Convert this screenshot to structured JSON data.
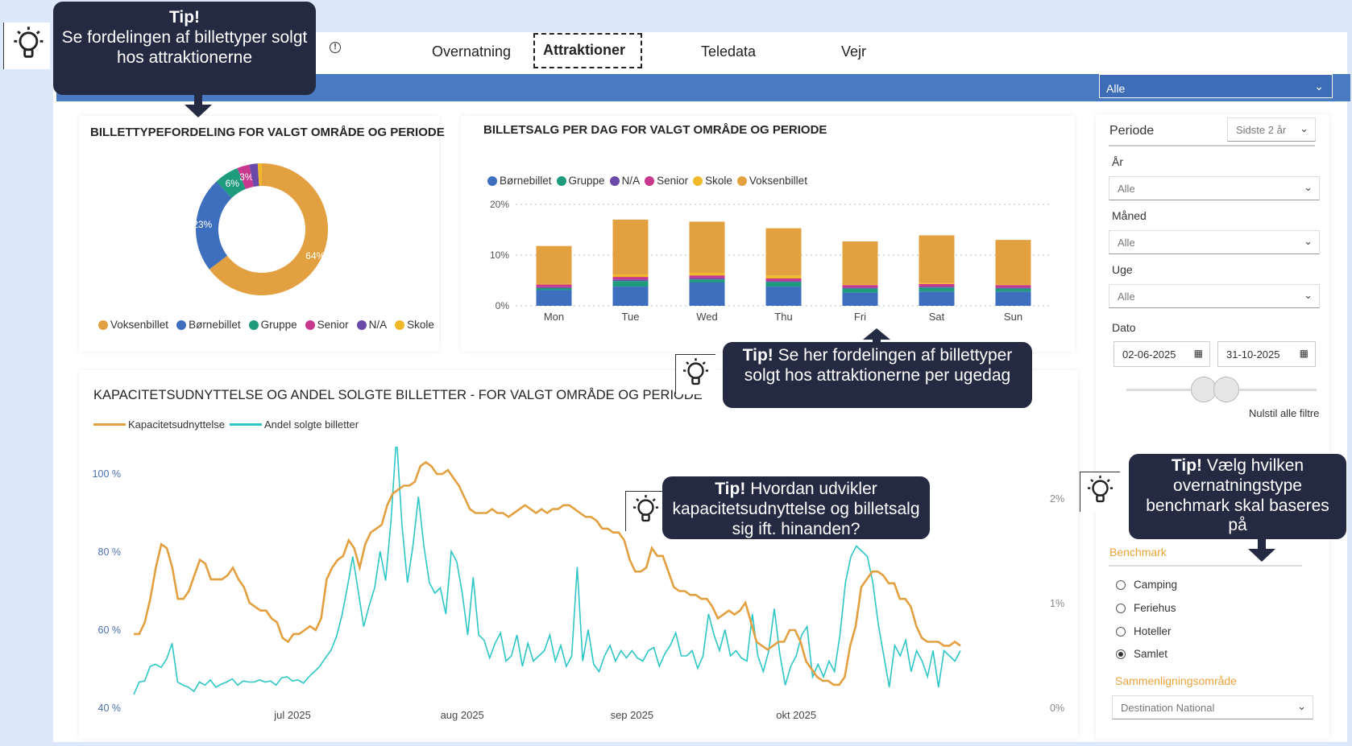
{
  "nav": {
    "tabs": [
      {
        "label": "Overnatning"
      },
      {
        "label": "Attraktioner"
      },
      {
        "label": "Teledata"
      },
      {
        "label": "Vejr"
      }
    ],
    "active_tab": "Attraktioner"
  },
  "top_filter": {
    "value": "Alle"
  },
  "donut": {
    "title": "BILLETTYPEFORDELING FOR VALGT OMRÅDE OG PERIODE",
    "legend": [
      "Voksenbillet",
      "Børnebillet",
      "Gruppe",
      "Senior",
      "N/A",
      "Skole"
    ]
  },
  "weekday": {
    "title": "BILLETSALG PER DAG FOR VALGT OMRÅDE OG PERIODE",
    "legend": [
      "Børnebillet",
      "Gruppe",
      "N/A",
      "Senior",
      "Skole",
      "Voksenbillet"
    ]
  },
  "line": {
    "title": "KAPACITETSUDNYTTELSE OG ANDEL SOLGTE BILLETTER - FOR VALGT OMRÅDE OG PERIODE",
    "legend": [
      "Kapacitetsudnyttelse",
      "Andel solgte billetter"
    ]
  },
  "colors": {
    "voksen": "#e3a040",
    "born": "#3e6fbf",
    "gruppe": "#1e9b7d",
    "senior": "#c9388f",
    "na": "#6b49a8",
    "skole": "#f0b92a",
    "kapacitet": "#e3a040",
    "andel": "#2ec6c6",
    "tip_bg": "#252a43",
    "band": "#4a7bc2"
  },
  "chart_data": [
    {
      "type": "pie",
      "title": "BILLETTYPEFORDELING FOR VALGT OMRÅDE OG PERIODE",
      "categories": [
        "Voksenbillet",
        "Børnebillet",
        "Gruppe",
        "Senior",
        "N/A",
        "Skole"
      ],
      "values": [
        64,
        23,
        6,
        3,
        2,
        1
      ],
      "labels": [
        "64%",
        "23%",
        "6%",
        "3%"
      ],
      "donut": true
    },
    {
      "type": "bar",
      "stacked": true,
      "title": "BILLETSALG PER DAG FOR VALGT OMRÅDE OG PERIODE",
      "categories": [
        "Mon",
        "Tue",
        "Wed",
        "Thu",
        "Fri",
        "Sat",
        "Sun"
      ],
      "series": [
        {
          "name": "Børnebillet",
          "values": [
            3.1,
            3.8,
            4.6,
            3.8,
            2.6,
            2.8,
            2.8
          ]
        },
        {
          "name": "Gruppe",
          "values": [
            0.4,
            1.1,
            0.6,
            0.9,
            0.8,
            0.8,
            0.6
          ]
        },
        {
          "name": "N/A",
          "values": [
            0.2,
            0.3,
            0.3,
            0.2,
            0.2,
            0.2,
            0.2
          ]
        },
        {
          "name": "Senior",
          "values": [
            0.5,
            0.5,
            0.5,
            0.5,
            0.5,
            0.5,
            0.5
          ]
        },
        {
          "name": "Skole",
          "values": [
            0.1,
            0.5,
            0.5,
            0.6,
            0.1,
            0.2,
            0.1
          ]
        },
        {
          "name": "Voksenbillet",
          "values": [
            7.5,
            10.8,
            10.1,
            9.3,
            8.5,
            9.4,
            8.8
          ]
        }
      ],
      "ylim": [
        0,
        20
      ],
      "yticks": [
        "0%",
        "10%",
        "20%"
      ]
    },
    {
      "type": "line",
      "title": "KAPACITETSUDNYTTELSE OG ANDEL SOLGTE BILLETTER - FOR VALGT OMRÅDE OG PERIODE",
      "x_range": [
        "2025-06-02",
        "2025-10-31"
      ],
      "xticks": [
        "jul 2025",
        "aug 2025",
        "sep 2025",
        "okt 2025"
      ],
      "y_left_ticks": [
        "40 %",
        "60 %",
        "80 %",
        "100 %"
      ],
      "y_right_ticks": [
        "0%",
        "1%",
        "2%"
      ],
      "y_left_lim": [
        40,
        107
      ],
      "y_right_lim": [
        0,
        2.5
      ],
      "series": [
        {
          "name": "Kapacitetsudnyttelse",
          "axis": "left",
          "values": [
            59,
            59,
            62,
            68,
            76,
            82,
            81,
            76,
            68,
            68,
            70,
            74,
            78,
            77,
            73,
            73,
            73,
            74,
            76,
            73,
            71,
            67,
            66,
            65,
            65,
            63,
            62,
            58,
            57,
            59,
            59,
            60,
            61,
            60,
            63,
            73,
            76,
            78,
            79,
            83,
            81,
            76,
            82,
            85,
            86,
            87,
            92,
            95,
            96,
            97,
            97,
            98,
            102,
            103,
            102,
            100,
            100,
            101,
            99,
            97,
            94,
            91,
            90,
            90,
            90,
            91,
            90,
            90,
            89,
            90,
            91,
            92,
            91,
            90,
            91,
            90,
            91,
            91,
            92,
            92,
            91,
            90,
            89,
            89,
            88,
            86,
            86,
            85,
            85,
            83,
            78,
            75,
            75,
            76,
            81,
            79,
            79,
            75,
            71,
            70,
            70,
            69,
            69,
            68,
            68,
            66,
            63,
            64,
            65,
            64,
            65,
            67,
            62,
            57,
            56,
            55,
            56,
            57,
            57,
            60,
            60,
            57,
            52,
            50,
            48,
            47,
            47,
            46,
            46,
            48,
            56,
            61,
            71,
            73,
            75,
            75,
            74,
            72,
            72,
            68,
            68,
            66,
            61,
            58,
            57,
            57,
            57,
            56,
            56,
            57,
            56
          ]
        },
        {
          "name": "Andel solgte billetter",
          "axis": "right",
          "values": [
            0.13,
            0.25,
            0.26,
            0.4,
            0.42,
            0.39,
            0.47,
            0.62,
            0.25,
            0.22,
            0.2,
            0.16,
            0.25,
            0.22,
            0.27,
            0.2,
            0.23,
            0.25,
            0.28,
            0.22,
            0.26,
            0.25,
            0.25,
            0.27,
            0.25,
            0.26,
            0.22,
            0.29,
            0.3,
            0.26,
            0.27,
            0.24,
            0.3,
            0.35,
            0.4,
            0.48,
            0.55,
            0.68,
            0.88,
            1.15,
            1.45,
            1.12,
            0.78,
            0.98,
            1.15,
            1.5,
            1.22,
            1.8,
            2.6,
            1.75,
            1.2,
            1.55,
            2.02,
            1.55,
            1.2,
            1.1,
            1.15,
            0.9,
            1.5,
            1.4,
            1.1,
            0.7,
            1.25,
            0.7,
            0.65,
            0.48,
            0.62,
            0.72,
            0.45,
            0.5,
            0.7,
            0.4,
            0.62,
            0.45,
            0.5,
            0.55,
            0.7,
            0.45,
            0.6,
            0.4,
            0.5,
            1.35,
            0.45,
            0.75,
            0.42,
            0.35,
            0.5,
            0.6,
            0.45,
            0.55,
            0.48,
            0.55,
            0.48,
            0.45,
            0.55,
            0.58,
            0.4,
            0.52,
            0.6,
            0.72,
            0.5,
            0.5,
            0.55,
            0.38,
            0.5,
            0.9,
            0.7,
            0.55,
            0.75,
            0.5,
            0.55,
            0.48,
            0.45,
            0.9,
            0.5,
            0.35,
            0.55,
            0.95,
            0.52,
            0.22,
            0.4,
            0.5,
            0.7,
            0.78,
            0.3,
            0.42,
            0.3,
            0.45,
            0.35,
            0.7,
            1.2,
            1.45,
            1.55,
            1.5,
            1.45,
            1.2,
            0.8,
            0.5,
            0.2,
            0.6,
            0.5,
            0.65,
            0.35,
            0.55,
            0.45,
            0.3,
            0.55,
            0.2,
            0.55,
            0.5,
            0.45,
            0.55
          ]
        }
      ]
    }
  ],
  "filters": {
    "periode_label": "Periode",
    "periode_value": "Sidste 2 år",
    "aar_label": "År",
    "aar_value": "Alle",
    "maaned_label": "Måned",
    "maaned_value": "Alle",
    "uge_label": "Uge",
    "uge_value": "Alle",
    "dato_label": "Dato",
    "date_from": "02-06-2025",
    "date_to": "31-10-2025",
    "reset": "Nulstil alle filtre",
    "benchmark_title": "Benchmark",
    "benchmark_options": [
      "Camping",
      "Feriehus",
      "Hoteller",
      "Samlet"
    ],
    "benchmark_selected": "Samlet",
    "compare_title": "Sammenligningsområde",
    "compare_value": "Destination National"
  },
  "tips": {
    "t1_head": "Tip!",
    "t1_body": "Se fordelingen af billettyper solgt hos attraktionerne",
    "t2_head": "Tip!",
    "t2_body": "Se her fordelingen af billettyper solgt hos attraktionerne per ugedag",
    "t3_head": "Tip!",
    "t3_body": "Hvordan udvikler kapacitetsudnyttelse og billetsalg sig ift. hinanden?",
    "t4_head": "Tip!",
    "t4_body": "Vælg hvilken overnatningstype benchmark skal baseres på"
  }
}
